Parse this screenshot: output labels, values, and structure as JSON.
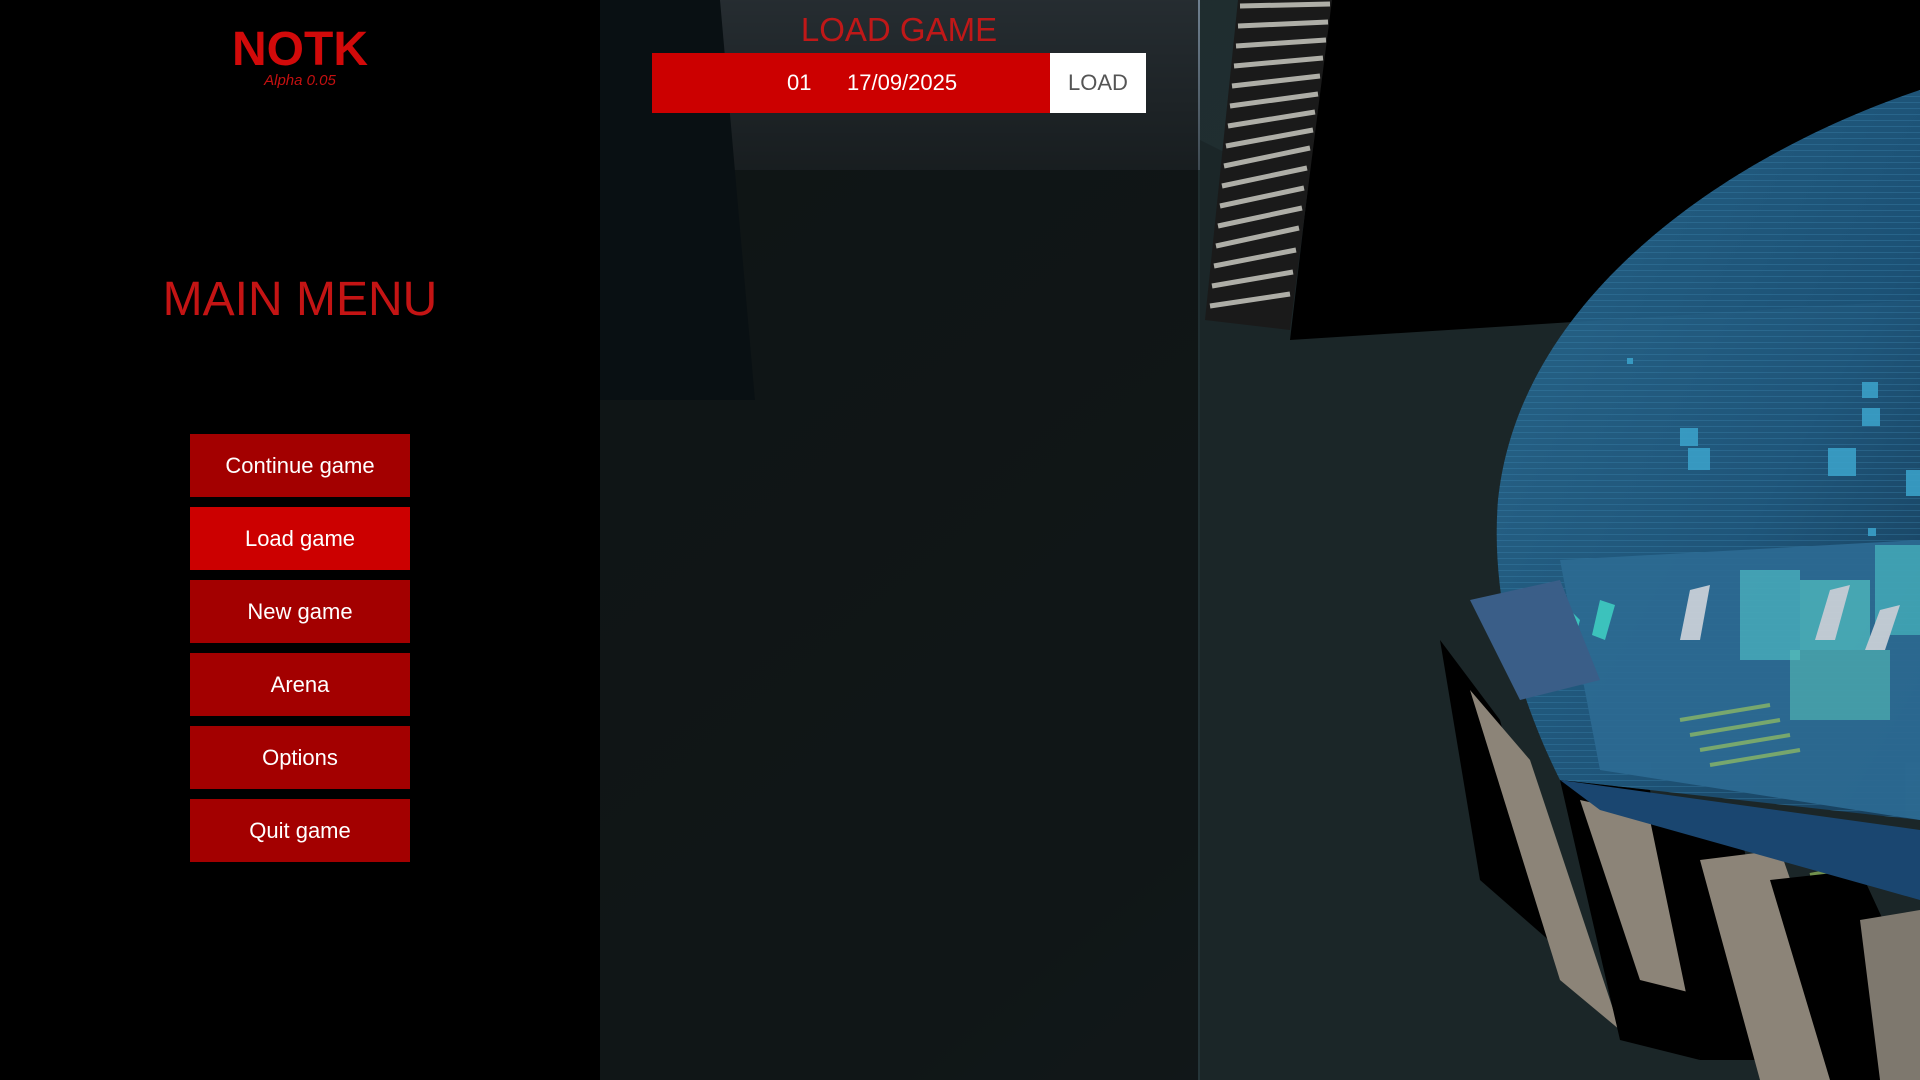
{
  "game": {
    "title": "NOTK",
    "version": "Alpha 0.05"
  },
  "main_menu": {
    "heading": "MAIN MENU",
    "items": [
      {
        "label": "Continue game",
        "selected": false
      },
      {
        "label": "Load game",
        "selected": true
      },
      {
        "label": "New game",
        "selected": false
      },
      {
        "label": "Arena",
        "selected": false
      },
      {
        "label": "Options",
        "selected": false
      },
      {
        "label": "Quit game",
        "selected": false
      }
    ]
  },
  "load_panel": {
    "heading": "LOAD GAME",
    "saves": [
      {
        "number": "01",
        "date": "17/09/2025"
      }
    ],
    "load_label": "LOAD"
  },
  "colors": {
    "accent": "#cc0000",
    "menu_button": "#a30000",
    "title_red": "#d20a0a"
  }
}
